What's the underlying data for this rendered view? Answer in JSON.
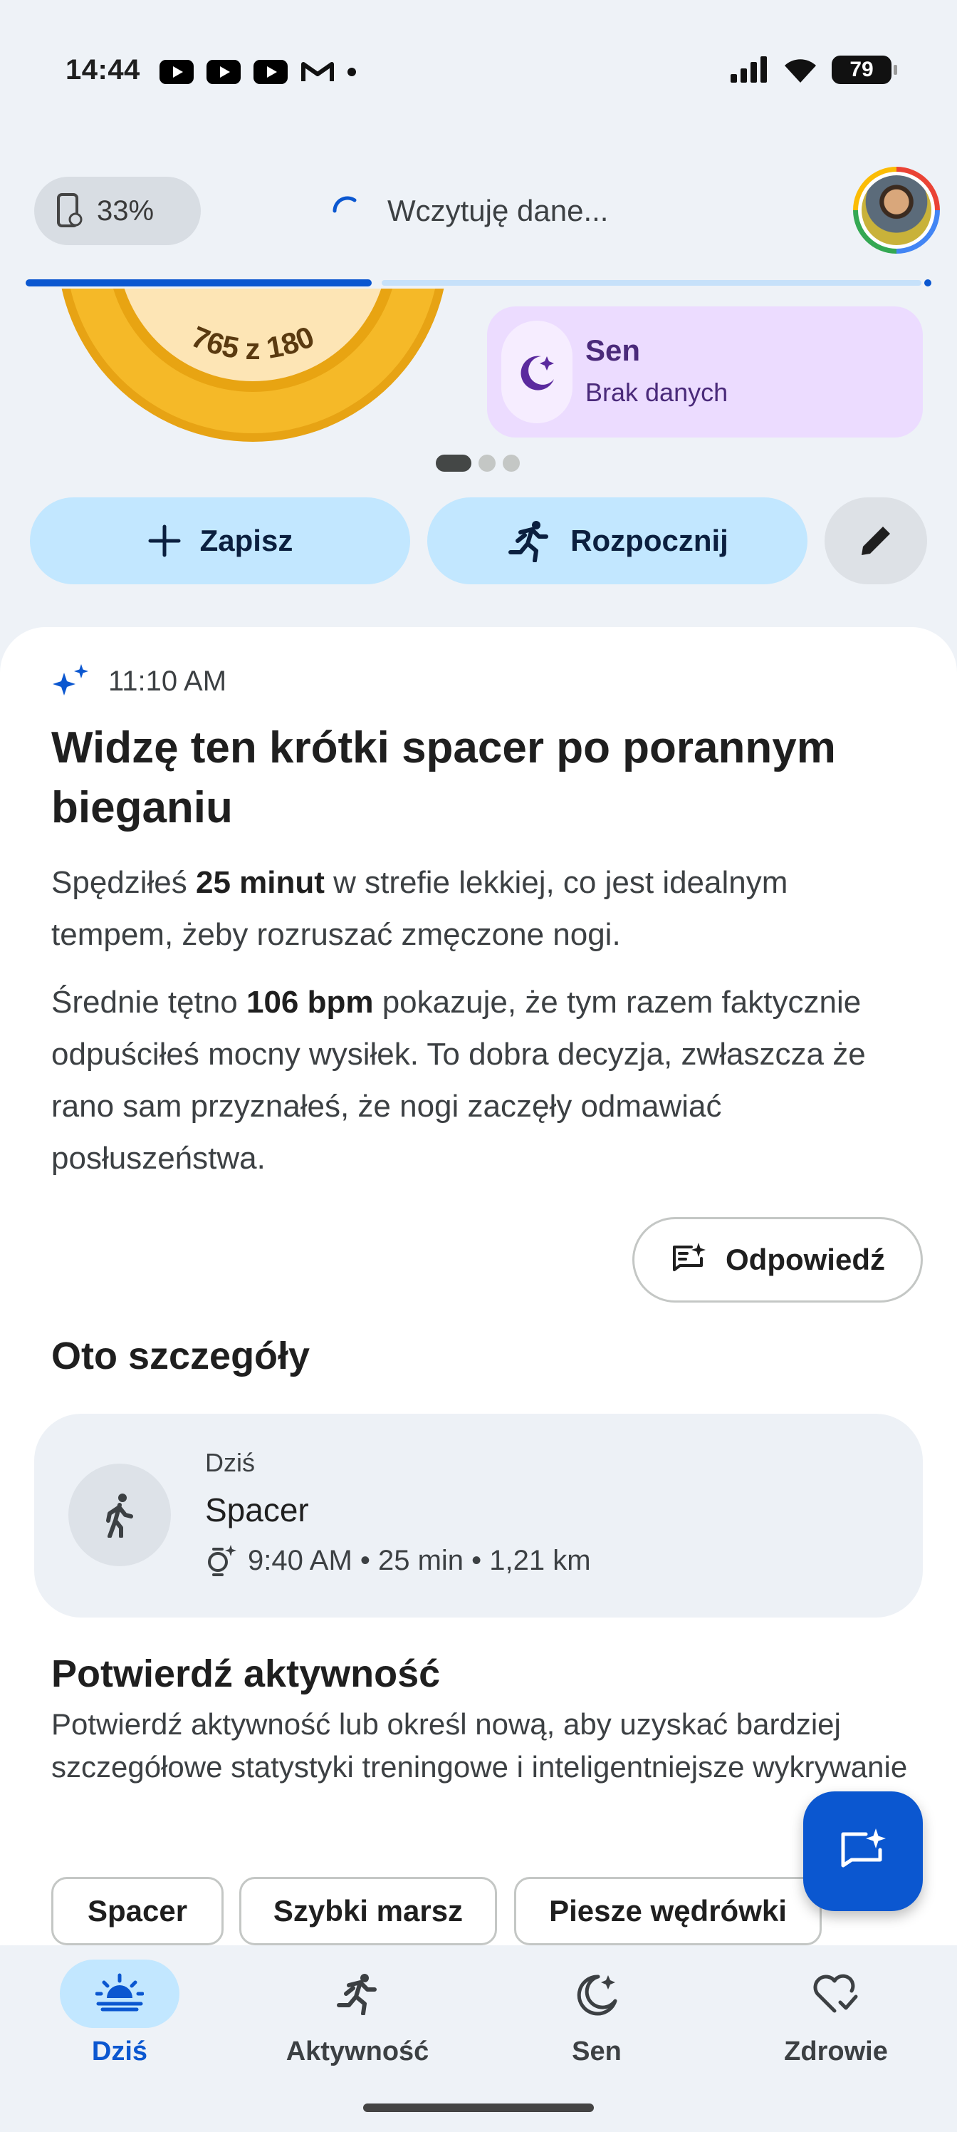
{
  "status_bar": {
    "time": "14:44",
    "notifications": [
      "youtube-icon",
      "youtube-icon",
      "youtube-icon",
      "gmail-icon",
      "dot"
    ],
    "battery": "79"
  },
  "top_bar": {
    "device_battery": "33%",
    "loading_text": "Wczytuję dane...",
    "sync_progress": 0.38
  },
  "carousel": {
    "ring_text": "765 z 180",
    "sleep_title": "Sen",
    "sleep_status": "Brak danych",
    "page_count": 3,
    "active_page": 0
  },
  "actions": {
    "save_label": "Zapisz",
    "start_label": "Rozpocznij"
  },
  "insight": {
    "time": "11:10 AM",
    "headline": "Widzę ten krótki spacer po porannym bieganiu",
    "p1_before": "Spędziłeś ",
    "p1_bold": "25 minut",
    "p1_after": " w strefie lekkiej, co jest idealnym tempem, żeby rozruszać zmęczone nogi.",
    "p2_before": "Średnie tętno ",
    "p2_bold": "106 bpm",
    "p2_after": " pokazuje, że tym razem faktycznie odpuściłeś mocny wysiłek. To dobra decyzja, zwłaszcza że rano sam przyznałeś, że nogi zaczęły odmawiać posłuszeństwa.",
    "reply_label": "Odpowiedź"
  },
  "details": {
    "title": "Oto szczegóły",
    "activity": {
      "day": "Dziś",
      "name": "Spacer",
      "meta": "9:40 AM • 25 min • 1,21 km"
    }
  },
  "confirm": {
    "title": "Potwierdź aktywność",
    "text": "Potwierdź aktywność lub określ nową, aby uzyskać bardziej szczegółowe statystyki treningowe i inteligentniejsze wykrywanie",
    "chips": [
      "Spacer",
      "Szybki marsz",
      "Piesze wędrówki"
    ]
  },
  "nav": {
    "items": [
      {
        "label": "Dziś",
        "icon": "sun-horizon-icon",
        "active": true
      },
      {
        "label": "Aktywność",
        "icon": "running-icon",
        "active": false
      },
      {
        "label": "Sen",
        "icon": "moon-icon",
        "active": false
      },
      {
        "label": "Zdrowie",
        "icon": "heart-check-icon",
        "active": false
      }
    ]
  },
  "colors": {
    "accent": "#0b57d0",
    "button_fill": "#c2e7ff",
    "ring": "#f0b020",
    "sleep_card": "#ecdcff"
  }
}
